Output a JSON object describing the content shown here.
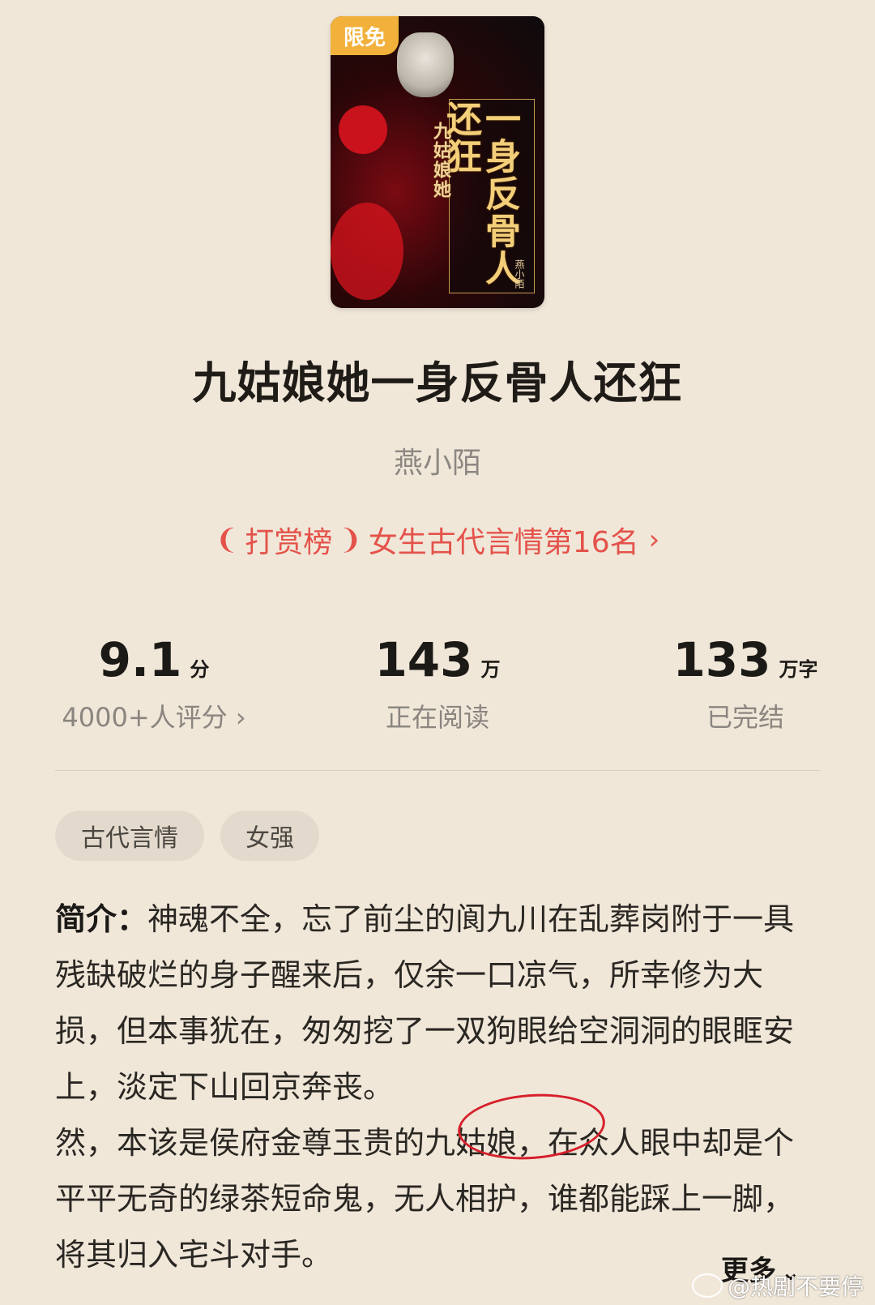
{
  "cover": {
    "badge": "限免",
    "title_main": "一身反骨人还狂",
    "title_sub": "九姑娘她",
    "author": "燕小陌"
  },
  "book": {
    "title": "九姑娘她一身反骨人还狂",
    "author": "燕小陌"
  },
  "rank": {
    "board": "打赏榜",
    "text": "女生古代言情第16名"
  },
  "stats": {
    "rating": {
      "value": "9.1",
      "unit": "分",
      "label": "4000+人评分"
    },
    "readers": {
      "value": "143",
      "unit": "万",
      "label": "正在阅读"
    },
    "words": {
      "value": "133",
      "unit": "万字",
      "label": "已完结"
    }
  },
  "tags": [
    "古代言情",
    "女强"
  ],
  "synopsis": {
    "lead": "简介：",
    "text": "神魂不全，忘了前尘的阆九川在乱葬岗附于一具残缺破烂的身子醒来后，仅余一口凉气，所幸修为大损，但本事犹在，匆匆挖了一双狗眼给空洞洞的眼眶安上，淡定下山回京奔丧。\n然，本该是侯府金尊玉贵的九姑娘，在众人眼中却是个平平无奇的绿茶短命鬼，无人相护，谁都能踩上一脚，将其归入宅斗对手。"
  },
  "more_label": "更多",
  "watermark": "@热剧不要停",
  "colors": {
    "background": "#f0e7d9",
    "accent_red": "#e4524a",
    "badge": "#f2b13a"
  }
}
